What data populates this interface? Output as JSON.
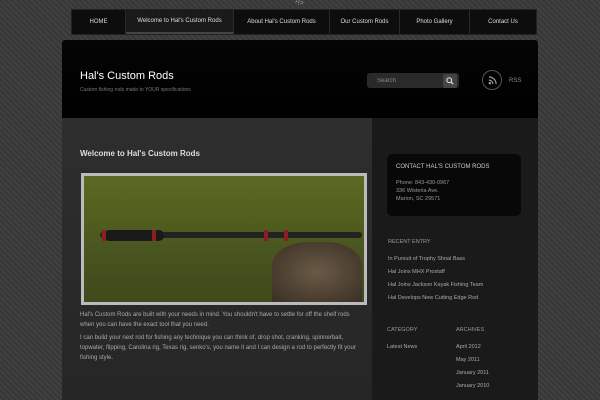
{
  "top_code": "*/>",
  "nav": {
    "items": [
      {
        "label": "HOME"
      },
      {
        "label": "Welcome to Hal's Custom Rods"
      },
      {
        "label": "About Hal's Custom Rods"
      },
      {
        "label": "Our Custom Rods"
      },
      {
        "label": "Photo Gallery"
      },
      {
        "label": "Contact Us"
      }
    ]
  },
  "header": {
    "title": "Hal's Custom Rods",
    "tagline": "Custom fishing rods made to YOUR specifications",
    "search_placeholder": "Search",
    "rss_label": "RSS"
  },
  "post": {
    "title": "Welcome to Hal's Custom Rods",
    "paragraph1": "Hal's Custom Rods are built with your needs in mind. You shouldn't have to settle for off the shelf rods when you can have the exact tool that you need.",
    "paragraph2": "I can build your next rod for fishing any technique you can think of, drop shot, cranking, spinnerbait, topwater, flipping, Carolina rig, Texas rig, senko's, you name it and I can design a rod to perfectly fit your fishing style."
  },
  "sidebar": {
    "contact": {
      "title": "CONTACT HAL'S CUSTOM RODS",
      "phone": "Phone: 843-430-0967",
      "address1": "336 Wisteria Ave.",
      "address2": "Marion, SC 29571"
    },
    "recent_heading": "RECENT ENTRY",
    "recent": [
      "In Pursuit of Trophy Shoal Bass",
      "Hal Joins MHX Prostaff",
      "Hal Joins Jackson Kayak Fishing Team",
      "Hal Develops New Cutting Edge Rod"
    ],
    "category_heading": "CATEGORY",
    "categories": [
      "Latest News"
    ],
    "archives_heading": "ARCHIVES",
    "archives": [
      "April 2012",
      "May 2011",
      "January 2011",
      "January 2010"
    ]
  },
  "colors": {
    "background": "#3a3a3a",
    "header": "#000000",
    "rod_accent": "#8b1e1e"
  }
}
